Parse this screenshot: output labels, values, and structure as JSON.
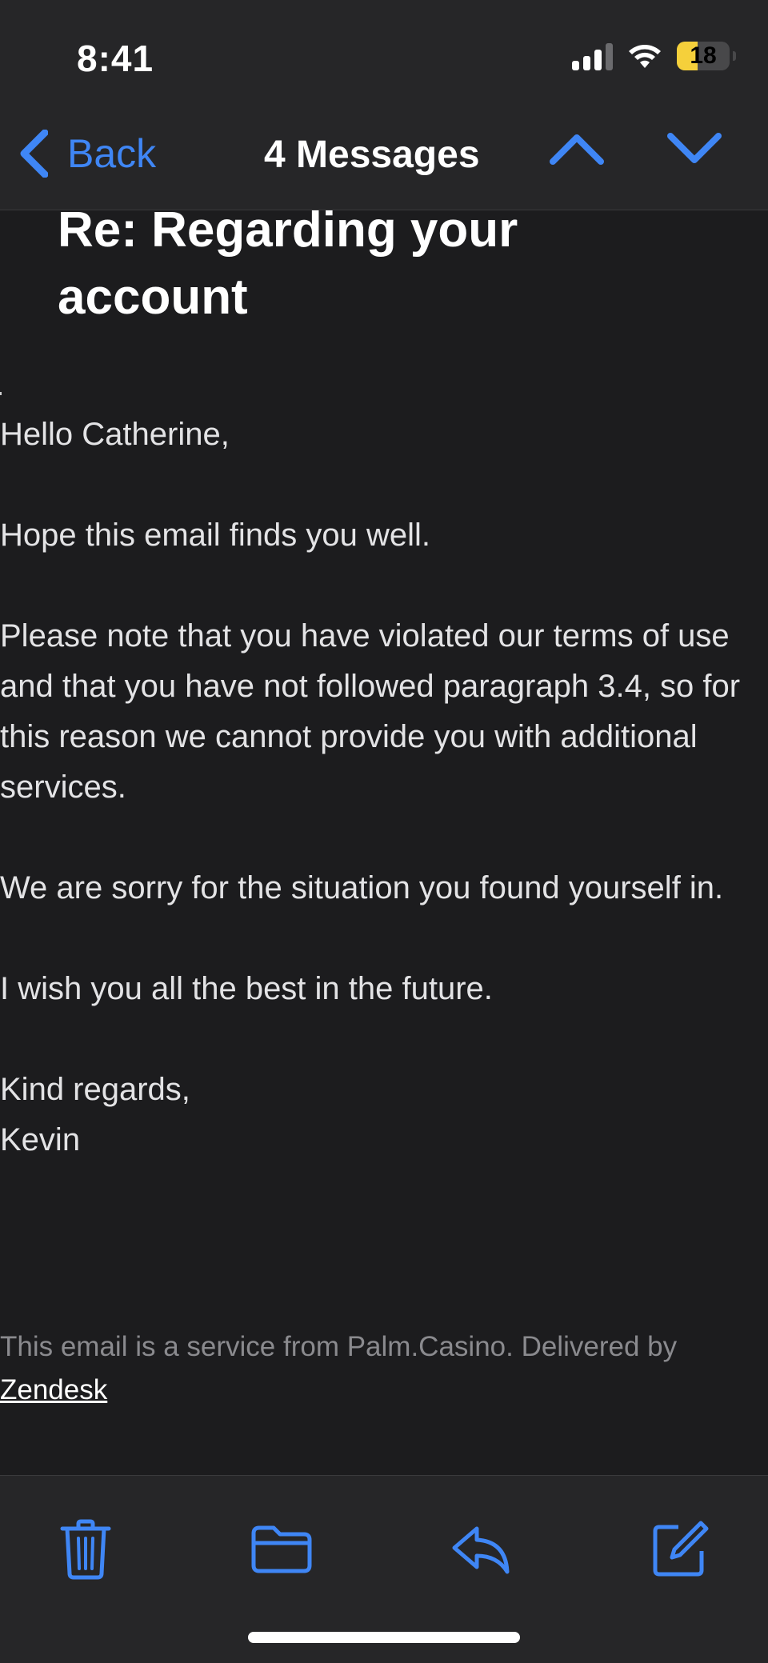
{
  "status_bar": {
    "time": "8:41",
    "battery_level": "18",
    "battery_fraction": 0.18,
    "battery_color": "#f5d03b"
  },
  "nav": {
    "back_label": "Back",
    "title": "4 Messages",
    "prev_icon": "chevron-up-icon",
    "next_icon": "chevron-down-icon"
  },
  "email": {
    "subject": "Re: Regarding your account",
    "greeting": "Hello Catherine,",
    "paragraphs": [
      "Hope this email finds you well.",
      "Please note that you have violated our terms of use and that you have not followed paragraph 3.4, so for this reason we cannot provide you with additional services.",
      "We are sorry for the situation you found yourself in.",
      "I wish you all the best in the future."
    ],
    "signoff": "Kind regards,",
    "signature": "Kevin",
    "footer_text": "This email is a service from Palm.Casino. Delivered by",
    "footer_link": "Zendesk"
  },
  "toolbar": {
    "icons": [
      "trash-icon",
      "folder-icon",
      "reply-icon",
      "compose-icon"
    ]
  },
  "colors": {
    "accent": "#3f86f5",
    "background": "#1c1c1e",
    "bar_background": "#262628"
  }
}
